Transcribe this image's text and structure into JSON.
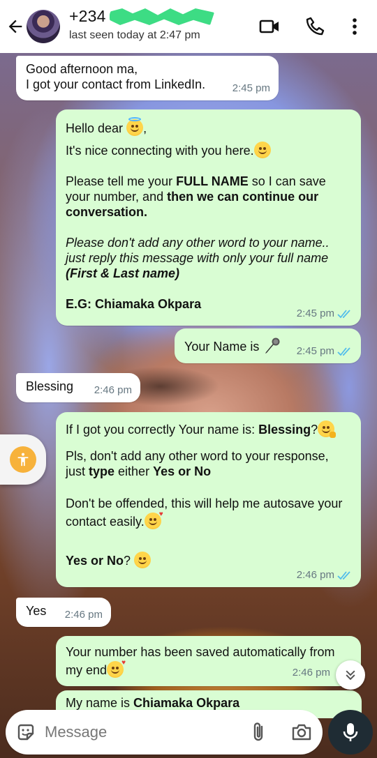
{
  "header": {
    "contact_name": "+234",
    "last_seen": "last seen today at 2:47 pm"
  },
  "messages": [
    {
      "dir": "in",
      "lines": [
        "Good afternoon ma,",
        "I got your contact from LinkedIn."
      ],
      "time": "2:45 pm"
    },
    {
      "dir": "out",
      "time": "2:45 pm",
      "status": "read",
      "p1": "Hello dear",
      "p1_end": ",",
      "p2": "It's nice connecting with you here.",
      "p3_a": "Please tell me your ",
      "p3_b": "FULL NAME",
      "p3_c": " so I can save your number, and ",
      "p3_d": "then we can continue our conversation.",
      "p4_a": "Please don't add any other word to your name.. just reply this message with only your full name ",
      "p4_b": "(First & Last name)",
      "p5": "E.G: Chiamaka Okpara"
    },
    {
      "dir": "out",
      "text": "Your Name is",
      "time": "2:45 pm",
      "status": "read"
    },
    {
      "dir": "in",
      "text": "Blessing",
      "time": "2:46 pm"
    },
    {
      "dir": "out",
      "time": "2:46 pm",
      "status": "read",
      "p1_a": "If I got you correctly Your name is: ",
      "p1_b": "Blessing",
      "p1_c": "?",
      "p2_a": "Pls, don't add any other word to your response, just ",
      "p2_b": "type",
      "p2_c": " either ",
      "p2_d": "Yes or No",
      "p3": "Don't be offended, this will help me autosave your contact easily.",
      "p4_a": "Yes or No",
      "p4_b": "? "
    },
    {
      "dir": "in",
      "text": "Yes",
      "time": "2:46 pm"
    },
    {
      "dir": "out",
      "text": "Your number has been saved automatically from my end",
      "time": "2:46 pm"
    },
    {
      "dir": "out",
      "text_a": "My name is ",
      "text_b": "Chiamaka Okpara"
    }
  ],
  "input": {
    "placeholder": "Message"
  },
  "icons": {
    "back": "arrow-left-icon",
    "video": "video-camera-icon",
    "call": "phone-icon",
    "menu": "more-vertical-icon",
    "sticker": "sticker-icon",
    "attach": "paperclip-icon",
    "camera": "camera-icon",
    "mic": "microphone-icon",
    "accessibility": "accessibility-icon",
    "scroll": "chevron-double-down-icon"
  },
  "colors": {
    "outgoing_bubble": "#d9fdd3",
    "incoming_bubble": "#ffffff",
    "read_ticks": "#53bdeb",
    "accessibility": "#f7b23b"
  }
}
